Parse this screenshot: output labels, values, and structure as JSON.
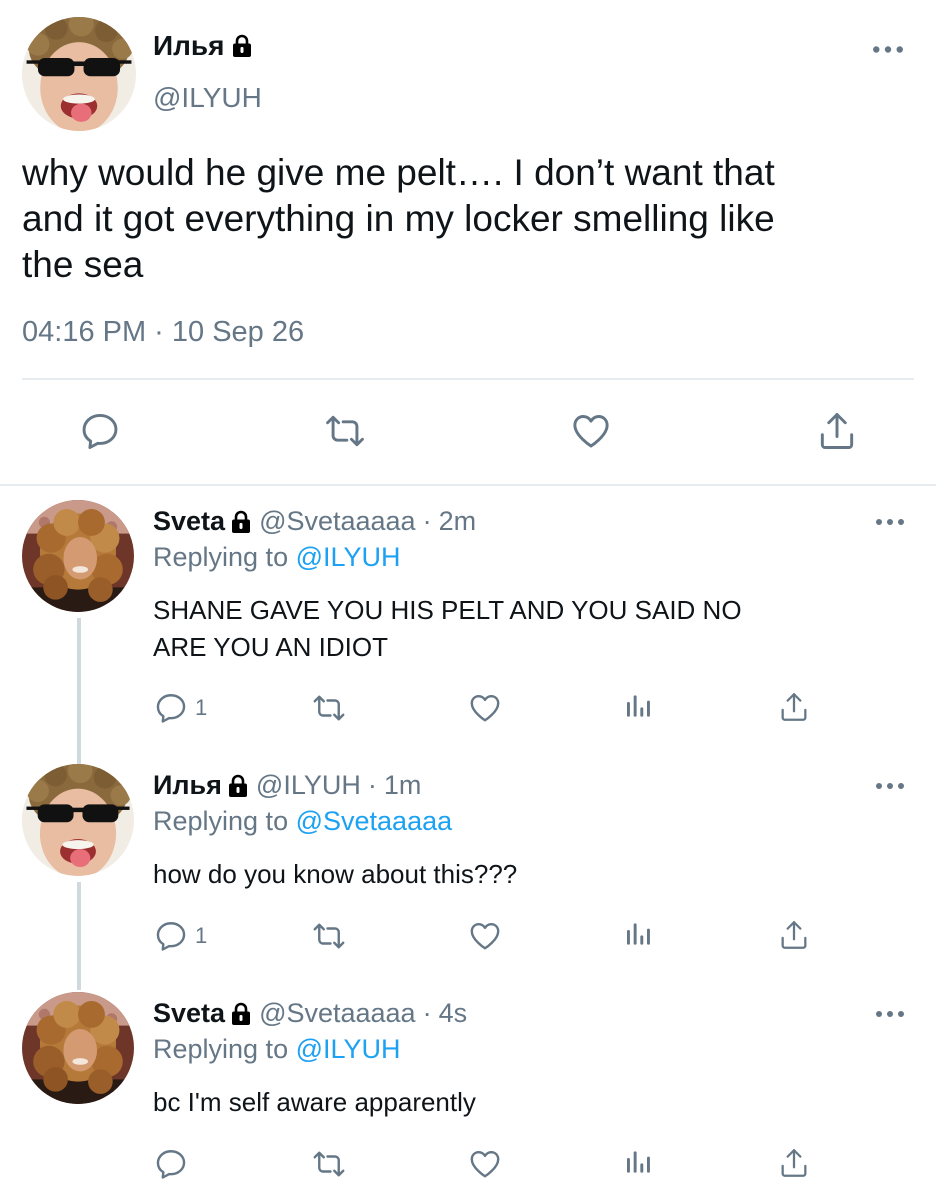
{
  "main_tweet": {
    "display_name": "Илья",
    "handle": "@ILYUH",
    "text": "why would he give me pelt…. I don’t want that\nand it got everything in my locker smelling like\nthe sea",
    "timestamp": "04:16 PM · 10 Sep 26",
    "actions": [
      "reply-icon",
      "retweet-icon",
      "like-icon",
      "share-icon"
    ]
  },
  "replies": [
    {
      "display_name": "Sveta",
      "handle": "@Svetaaaaa",
      "separator": "·",
      "time": "2m",
      "replying_label": "Replying to",
      "replying_to": "@ILYUH",
      "text": "SHANE GAVE YOU HIS PELT AND YOU SAID NO\nARE YOU AN IDIOT",
      "reply_count": "1"
    },
    {
      "display_name": "Илья",
      "handle": "@ILYUH",
      "separator": "·",
      "time": "1m",
      "replying_label": "Replying to",
      "replying_to": "@Svetaaaaa",
      "text": "how do you know about this???",
      "reply_count": "1"
    },
    {
      "display_name": "Sveta",
      "handle": "@Svetaaaaa",
      "separator": "·",
      "time": "4s",
      "replying_label": "Replying to",
      "replying_to": "@ILYUH",
      "text": "bc I'm self aware apparently",
      "reply_count": ""
    }
  ],
  "colors": {
    "text": "#0f1419",
    "secondary": "#657786",
    "link": "#1da1f2",
    "divider": "#e6ecf0",
    "thread_line": "#cfd9de"
  }
}
